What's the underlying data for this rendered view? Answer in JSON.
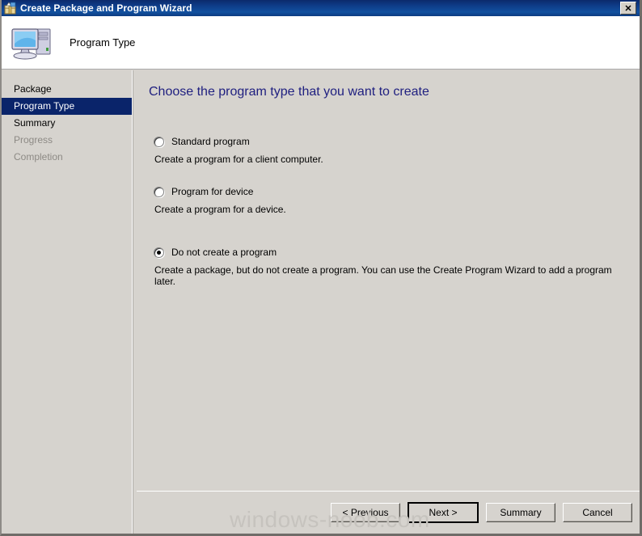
{
  "window": {
    "title": "Create Package and Program Wizard",
    "title_icon": "package-icon",
    "close_label": "✕"
  },
  "header": {
    "icon": "computer-icon",
    "title": "Program Type"
  },
  "sidebar": {
    "items": [
      {
        "label": "Package",
        "state": "enabled"
      },
      {
        "label": "Program Type",
        "state": "active"
      },
      {
        "label": "Summary",
        "state": "enabled"
      },
      {
        "label": "Progress",
        "state": "disabled"
      },
      {
        "label": "Completion",
        "state": "disabled"
      }
    ]
  },
  "main": {
    "page_title": "Choose the program type that you want to create",
    "options": [
      {
        "label": "Standard program",
        "description": "Create a program for a client computer.",
        "selected": false
      },
      {
        "label": "Program for device",
        "description": "Create a program for a device.",
        "selected": false
      },
      {
        "label": "Do not create a program",
        "description": "Create a package, but do not create a program. You can use the Create Program Wizard to add a program later.",
        "selected": true
      }
    ]
  },
  "footer": {
    "buttons": [
      {
        "label": "< Previous",
        "default": false
      },
      {
        "label": "Next >",
        "default": true
      },
      {
        "label": "Summary",
        "default": false
      },
      {
        "label": "Cancel",
        "default": false
      }
    ]
  },
  "watermark": {
    "text": "windows-noob.com"
  },
  "colors": {
    "titlebar": "#0e3c88",
    "dialog_face": "#d6d3ce",
    "heading": "#202080",
    "nav_active_bg": "#0a246a",
    "nav_disabled_text": "#8d8a85",
    "watermark": "#c6c3be"
  }
}
